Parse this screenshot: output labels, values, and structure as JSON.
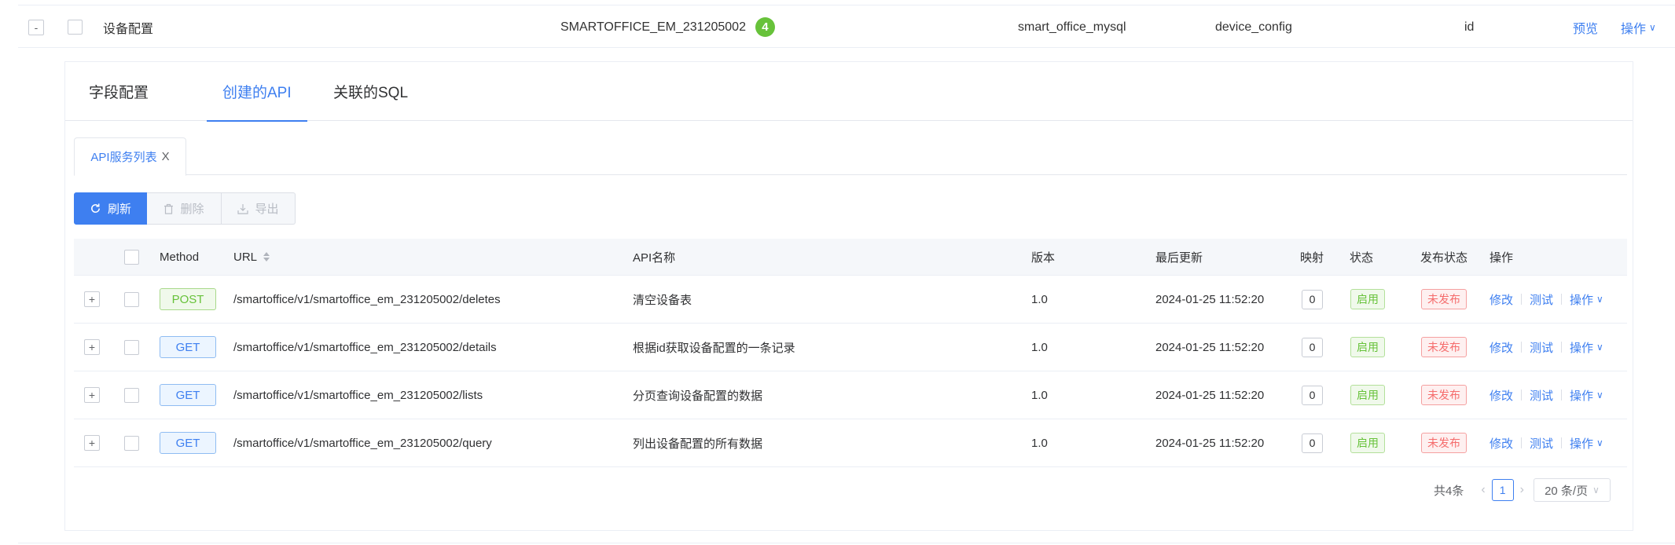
{
  "parent_row": {
    "expand_symbol": "-",
    "name": "设备配置",
    "code": "SMARTOFFICE_EM_231205002",
    "api_count": "4",
    "database": "smart_office_mysql",
    "table_name": "device_config",
    "primary_key": "id",
    "preview_label": "预览",
    "operate_label": "操作"
  },
  "tabs": [
    {
      "label": "字段配置",
      "active": false
    },
    {
      "label": "创建的API",
      "active": true
    },
    {
      "label": "关联的SQL",
      "active": false
    }
  ],
  "subtab": {
    "label": "API服务列表",
    "close": "X"
  },
  "toolbar": {
    "refresh_label": "刷新",
    "delete_label": "删除",
    "export_label": "导出"
  },
  "table": {
    "headers": {
      "method": "Method",
      "url": "URL",
      "api_name": "API名称",
      "version": "版本",
      "updated": "最后更新",
      "mapping": "映射",
      "status": "状态",
      "publish": "发布状态",
      "actions": "操作"
    },
    "rows": [
      {
        "expand": "+",
        "method": "POST",
        "url": "/smartoffice/v1/smartoffice_em_231205002/deletes",
        "name": "清空设备表",
        "version": "1.0",
        "updated": "2024-01-25 11:52:20",
        "mapping": "0",
        "status": "启用",
        "publish": "未发布",
        "edit": "修改",
        "test": "测试",
        "more": "操作"
      },
      {
        "expand": "+",
        "method": "GET",
        "url": "/smartoffice/v1/smartoffice_em_231205002/details",
        "name": "根据id获取设备配置的一条记录",
        "version": "1.0",
        "updated": "2024-01-25 11:52:20",
        "mapping": "0",
        "status": "启用",
        "publish": "未发布",
        "edit": "修改",
        "test": "测试",
        "more": "操作"
      },
      {
        "expand": "+",
        "method": "GET",
        "url": "/smartoffice/v1/smartoffice_em_231205002/lists",
        "name": "分页查询设备配置的数据",
        "version": "1.0",
        "updated": "2024-01-25 11:52:20",
        "mapping": "0",
        "status": "启用",
        "publish": "未发布",
        "edit": "修改",
        "test": "测试",
        "more": "操作"
      },
      {
        "expand": "+",
        "method": "GET",
        "url": "/smartoffice/v1/smartoffice_em_231205002/query",
        "name": "列出设备配置的所有数据",
        "version": "1.0",
        "updated": "2024-01-25 11:52:20",
        "mapping": "0",
        "status": "启用",
        "publish": "未发布",
        "edit": "修改",
        "test": "测试",
        "more": "操作"
      }
    ]
  },
  "pagination": {
    "total_label": "共4条",
    "current_page": "1",
    "page_size_label": "20 条/页"
  },
  "icons": {
    "refresh": "refresh-icon",
    "delete": "trash-icon",
    "export": "download-icon",
    "sort": "sort-icon",
    "chevron": "chevron-down-icon"
  },
  "colors": {
    "primary": "#3e7ff0",
    "success": "#67c23a",
    "danger": "#f56c6c"
  }
}
